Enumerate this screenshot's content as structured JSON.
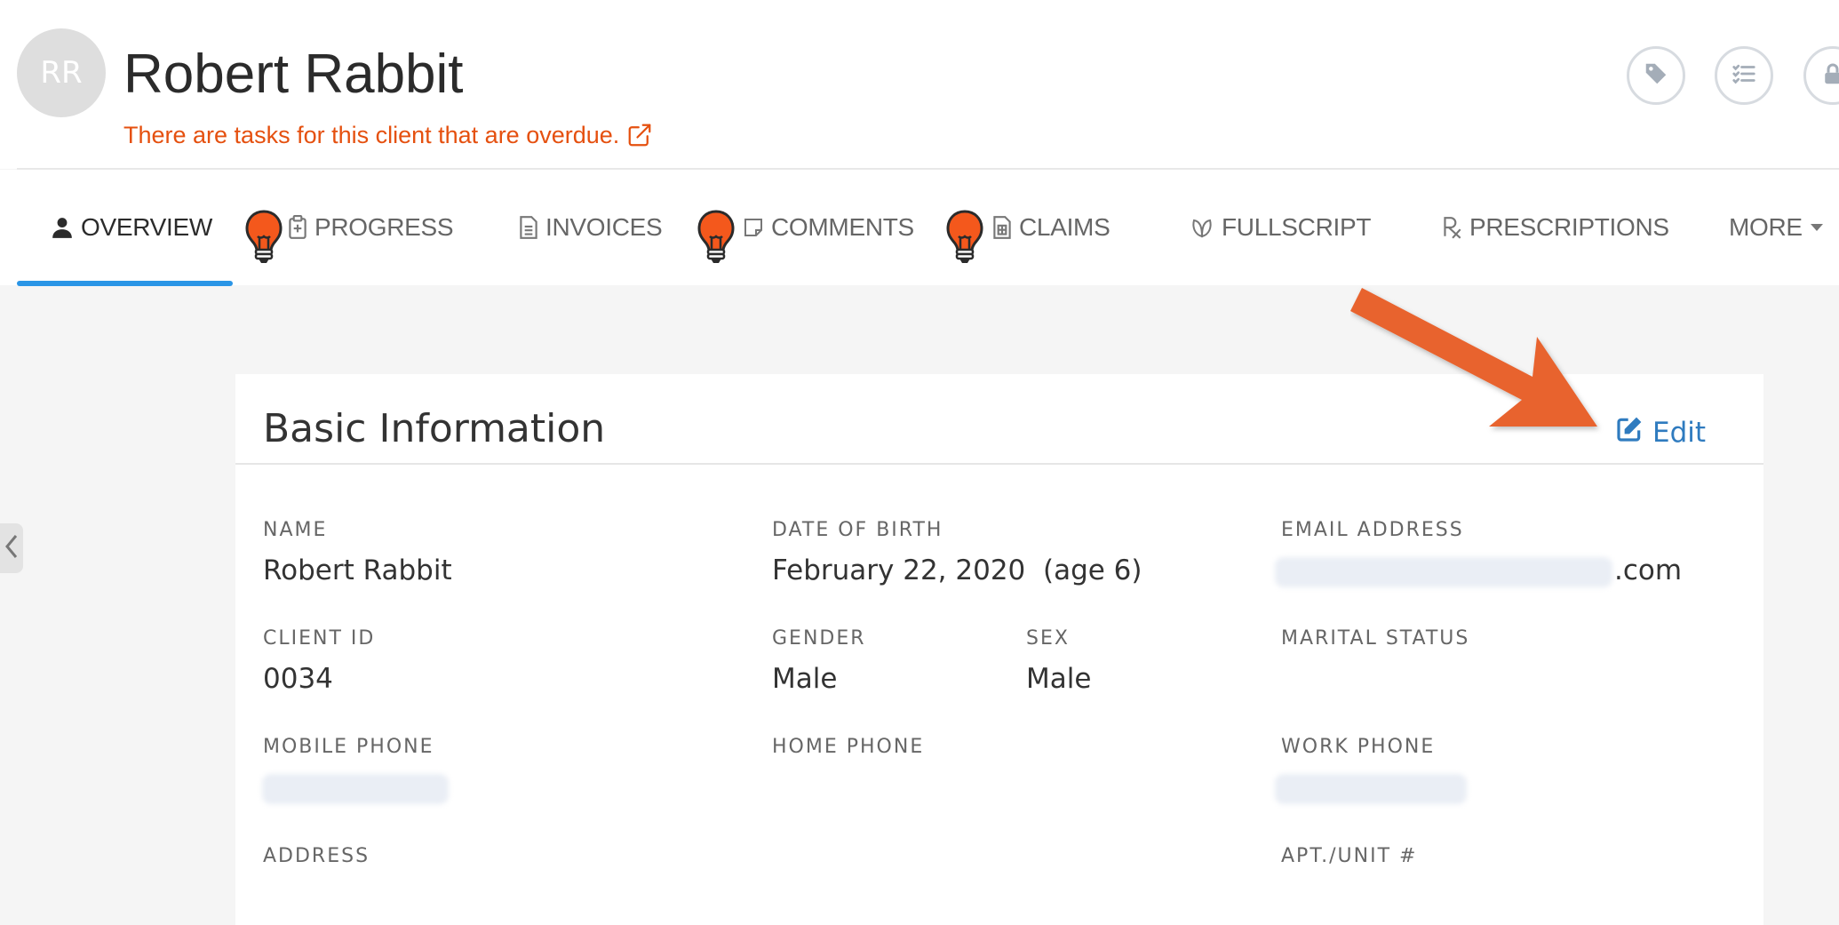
{
  "client": {
    "initials": "RR",
    "name": "Robert Rabbit",
    "overdue_message": "There are tasks for this client that are overdue."
  },
  "header_actions": [
    {
      "icon": "tag-icon"
    },
    {
      "icon": "checklist-icon"
    },
    {
      "icon": "lock-icon"
    }
  ],
  "tabs": {
    "overview": "OVERVIEW",
    "progress": "PROGRESS",
    "invoices": "INVOICES",
    "comments": "COMMENTS",
    "claims": "CLAIMS",
    "fullscript": "FULLSCRIPT",
    "prescriptions": "PRESCRIPTIONS",
    "more": "MORE",
    "active": "overview"
  },
  "basic_info": {
    "title": "Basic Information",
    "edit_label": "Edit",
    "fields": {
      "name": {
        "label": "NAME",
        "value": "Robert Rabbit"
      },
      "dob": {
        "label": "DATE OF BIRTH",
        "value": "February 22, 2020  (age 6)"
      },
      "email": {
        "label": "EMAIL ADDRESS",
        "value_suffix": ".com"
      },
      "client_id": {
        "label": "CLIENT ID",
        "value": "0034"
      },
      "gender": {
        "label": "GENDER",
        "value": "Male"
      },
      "sex": {
        "label": "SEX",
        "value": "Male"
      },
      "marital_status": {
        "label": "MARITAL STATUS",
        "value": ""
      },
      "mobile_phone": {
        "label": "MOBILE PHONE"
      },
      "home_phone": {
        "label": "HOME PHONE",
        "value": ""
      },
      "work_phone": {
        "label": "WORK PHONE"
      },
      "address": {
        "label": "ADDRESS"
      },
      "apt_unit": {
        "label": "APT./UNIT #"
      }
    }
  },
  "colors": {
    "accent": "#2a95e6",
    "alert": "#e5500f",
    "link": "#2f7bbf",
    "annotation_arrow": "#e8632e"
  }
}
